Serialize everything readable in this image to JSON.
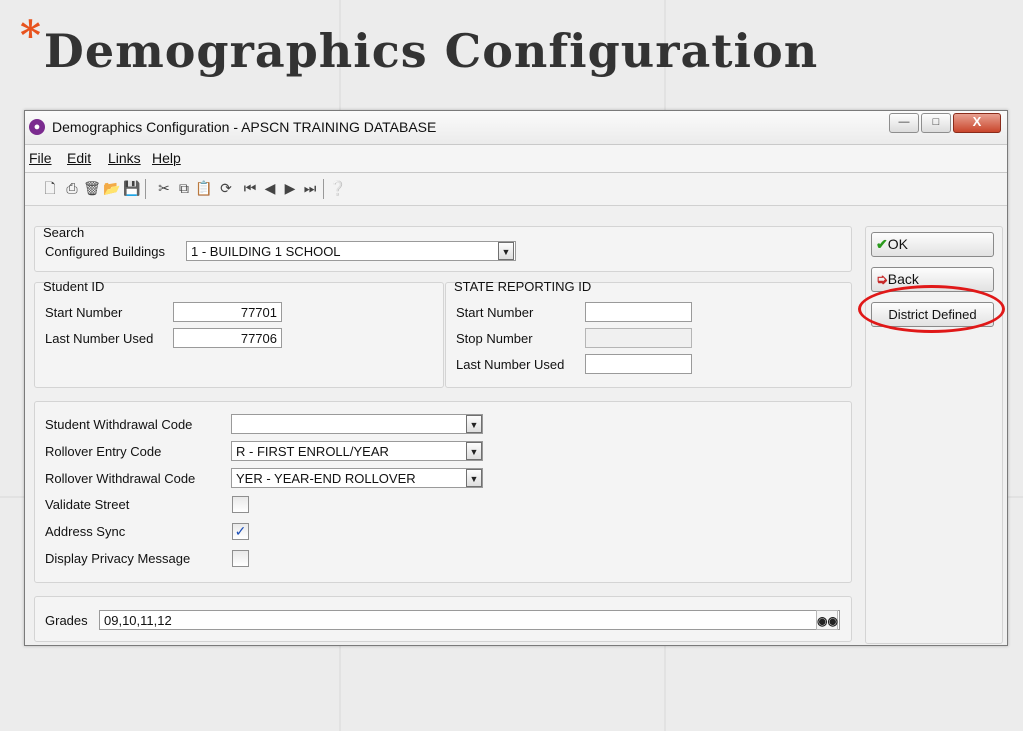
{
  "slide": {
    "title_star": "*",
    "title": "Demographics Configuration"
  },
  "window": {
    "title": "Demographics Configuration - APSCN TRAINING DATABASE",
    "icon": "app-logo-icon"
  },
  "menu": [
    "File",
    "Edit",
    "Links",
    "Help"
  ],
  "search": {
    "group": "Search",
    "buildings_label": "Configured Buildings",
    "buildings_value": "1 - BUILDING 1 SCHOOL"
  },
  "student_id": {
    "group": "Student ID",
    "start_label": "Start Number",
    "start_value": "77701",
    "last_label": "Last Number Used",
    "last_value": "77706"
  },
  "state_id": {
    "group": "STATE REPORTING ID",
    "start_label": "Start Number",
    "start_value": "",
    "stop_label": "Stop Number",
    "stop_value": "",
    "last_label": "Last Number Used",
    "last_value": ""
  },
  "codes": {
    "withdrawal_label": "Student Withdrawal Code",
    "withdrawal_value": "",
    "entry_label": "Rollover Entry Code",
    "entry_value": "R - FIRST ENROLL/YEAR",
    "rollwd_label": "Rollover Withdrawal Code",
    "rollwd_value": "YER - YEAR-END ROLLOVER",
    "validate_label": "Validate Street",
    "validate_checked": false,
    "sync_label": "Address Sync",
    "sync_checked": true,
    "privacy_label": "Display Privacy Message",
    "privacy_checked": false
  },
  "grades": {
    "label": "Grades",
    "value": "09,10,11,12"
  },
  "buttons": {
    "ok": "OK",
    "back": "Back",
    "district": "District Defined"
  },
  "colors": {
    "accent_title_star": "#e8531e",
    "highlight": "#e01818",
    "ok_check": "#2a9a1c",
    "back_arrow": "#c62828"
  }
}
